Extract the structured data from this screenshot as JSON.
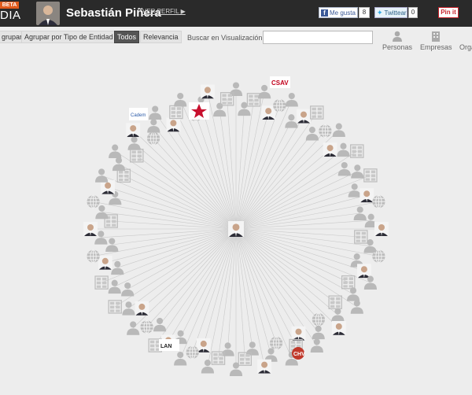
{
  "header": {
    "beta_badge": "BETA",
    "brand": "DIA",
    "person_name": "Sebastián Piñera",
    "view_profile": "VER PERFIL ▶",
    "facebook_like": "Me gusta",
    "facebook_count": "8",
    "twitter_label": "Twittear",
    "twitter_count": "0",
    "pinterest_label": "Pin it"
  },
  "toolbar": {
    "group_button": "grupar",
    "group_by_entity_type": "Agrupar por Tipo de Entidad",
    "all_button": "Todos",
    "relevance_button": "Relevancia",
    "search_label": "Buscar en Visualización",
    "search_placeholder": "",
    "filter_people": "Personas",
    "filter_companies": "Empresas",
    "filter_orgs": "Orga"
  },
  "graph": {
    "center_node": "Sebastián Piñera",
    "logo_labels": {
      "csav": "CSAV",
      "rn": "Renovación Nacional",
      "cadem": "Cadem",
      "lan": "LAN",
      "chv": "CHV"
    }
  },
  "colors": {
    "topbar": "#2a2a2a",
    "beta": "#e05a1c",
    "background": "#ededed",
    "node_icon": "#b8b8b8",
    "edge": "#c9c9c9"
  },
  "icons": {
    "person_node": "person-icon",
    "building_node": "building-icon",
    "globe_node": "globe-icon"
  }
}
